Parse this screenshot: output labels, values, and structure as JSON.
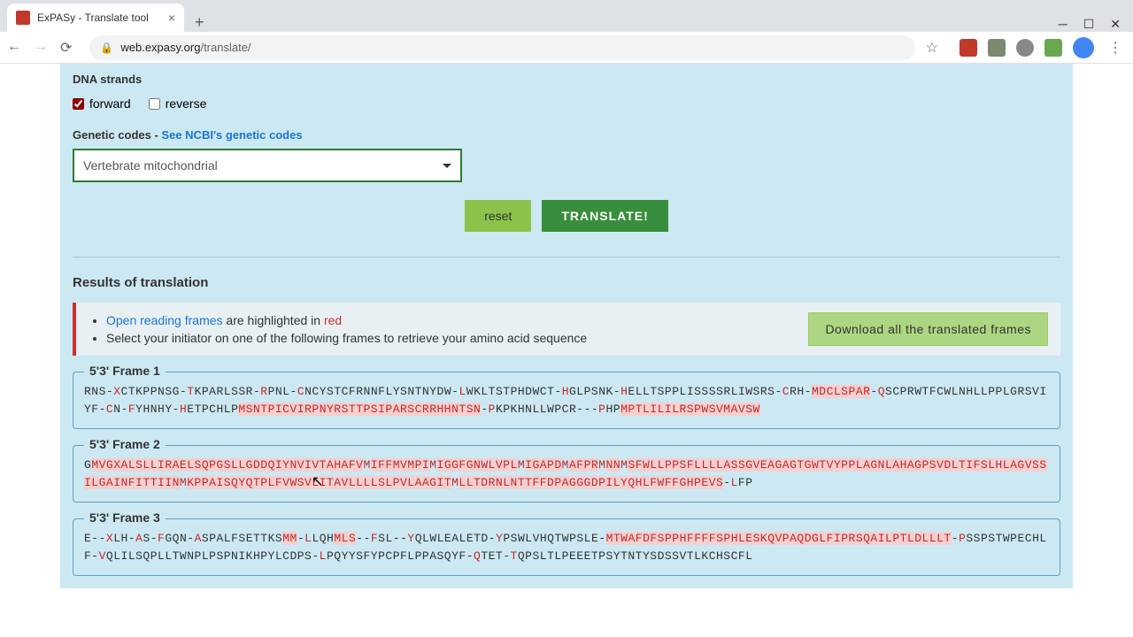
{
  "browser": {
    "tab_title": "ExPASy - Translate tool",
    "url_host": "web.expasy.org",
    "url_path": "/translate/",
    "star": "☆"
  },
  "form": {
    "strands_label": "DNA strands",
    "forward_label": "forward",
    "reverse_label": "reverse",
    "codes_prefix": "Genetic codes - ",
    "codes_link": "See NCBI's genetic codes",
    "select_value": "Vertebrate mitochondrial",
    "reset_label": "reset",
    "translate_label": "TRANSLATE!"
  },
  "results": {
    "header": "Results of translation",
    "orf_link": "Open reading frames",
    "orf_text": " are highlighted in ",
    "red": "red",
    "initiator_text": "Select your initiator on one of the following frames to retrieve your amino acid sequence",
    "download_label": "Download all the translated frames",
    "frame1_title": "5'3' Frame 1",
    "frame2_title": "5'3' Frame 2",
    "frame3_title": "5'3' Frame 3",
    "f1_a": "RNS-",
    "f1_b": "X",
    "f1_c": "CTKPPNSG-",
    "f1_d": "T",
    "f1_e": "KPARLSSR-",
    "f1_f": "R",
    "f1_g": "PNL-",
    "f1_h": "C",
    "f1_i": "NCYSTCFRNNFLYSNTNYDW-",
    "f1_j": "L",
    "f1_k": "WKLTSTPHDWCT-",
    "f1_l": "H",
    "f1_m": "GLPSNK-",
    "f1_n": "H",
    "f1_o": "ELLTSPPLISSSSRLIWSRS-",
    "f1_p": "C",
    "f1_q": "RH-",
    "f1_r": "MDCLSPAR",
    "f1_s": "-",
    "f1_t": "Q",
    "f1_u": "SCPRWTFCWLNHLLPPLGRSVIYF-",
    "f1_v": "C",
    "f1_w": "N-",
    "f1_x": "F",
    "f1_y": "YHNHY-",
    "f1_z": "H",
    "f1_aa": "ETPCHLP",
    "f1_ab": "MSNTPICVIRPNYRSTTPSIPARSCRRHHNTSN",
    "f1_ac": "-",
    "f1_ad": "P",
    "f1_ae": "KPKHNLLWPCR---",
    "f1_af": "P",
    "f1_ag": "HP",
    "f1_ah": "MPTLILILRSPWSVMAVSW",
    "f2_a": "G",
    "f2_b": "MVGXALSLLIRAELSQPGSLLGDDQIYNVIVTAHAFV",
    "f2_c": "M",
    "f2_d": "IFF",
    "f2_e": "MVM",
    "f2_f": "PI",
    "f2_g": "M",
    "f2_h": "IGGFGNWLVPL",
    "f2_i": "M",
    "f2_j": "IGAPD",
    "f2_k": "M",
    "f2_l": "AFPR",
    "f2_m": "M",
    "f2_n": "NN",
    "f2_o": "M",
    "f2_p": "SFWLLPPSFLLLLASSGVEAGAGTGWTVYPPLAGNLAHAGPSVDLTIFSLHLAGVSSILGAINFITTIIN",
    "f2_q": "M",
    "f2_r": "KPPAISQYQTPLFVWSVLITAVLLLLSLPVLAAGIT",
    "f2_s": "M",
    "f2_t": "LLTDRNLNTTFFDPAGGGDPILYQHLFWFFGHPEVS",
    "f2_u": "-",
    "f2_v": "L",
    "f2_w": "FP",
    "f3_a": "E--",
    "f3_b": "X",
    "f3_c": "LH-",
    "f3_d": "A",
    "f3_e": "S-",
    "f3_f": "F",
    "f3_g": "GQN-",
    "f3_h": "A",
    "f3_i": "SPALFSETTKS",
    "f3_j": "MM",
    "f3_k": "-",
    "f3_l": "L",
    "f3_m": "LQH",
    "f3_n": "MLS",
    "f3_o": "--",
    "f3_p": "F",
    "f3_q": "SL--",
    "f3_r": "Y",
    "f3_s": "QLWLEALETD-",
    "f3_t": "Y",
    "f3_u": "PSWLVHQTWPSLE-",
    "f3_v": "MTWAFDFSPPHFFFFSPHLESKQVPAQDGLFIPRSQAILPTLDLLLT",
    "f3_w": "-",
    "f3_x": "P",
    "f3_y": "SSPSTWPECHLF-",
    "f3_z": "V",
    "f3_aa": "QLILSQPLLTWNPLPSPNIKHPYLCDPS-",
    "f3_ab": "L",
    "f3_ac": "PQYYSFYPCPFLPPASQYF-",
    "f3_ad": "Q",
    "f3_ae": "TET-",
    "f3_af": "T",
    "f3_ag": "QPSLTLPEEETPSYTNTYSDSSVTLKCHSCFL"
  }
}
